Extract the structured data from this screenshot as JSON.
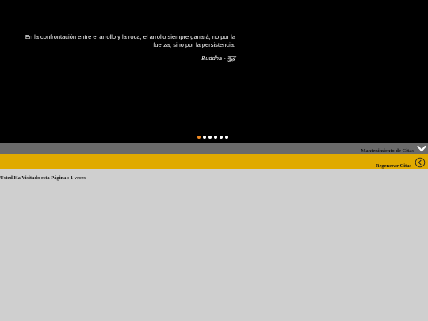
{
  "slider": {
    "quote": "En la confrontación entre el arrollo y la roca, el arrollo siempre ganará, no por la fuerza, sino por la persistencia.",
    "author": "Buddha - बुद्ध",
    "dot_count": 6,
    "active_index": 0
  },
  "header": {
    "maintenance_label": "Mantenimiento de Citas",
    "regenerate_label": "Regenerar Citas"
  },
  "footer": {
    "visits_text": "Usted Ha Visitado esta Página : 1 veces"
  },
  "icons": {
    "menu_toggle": "chevron-down-icon",
    "regenerate": "circle-arrow-left-icon"
  },
  "colors": {
    "hero_bg": "#000000",
    "grey_bar": "#6a6a6a",
    "yellow_bar": "#e0aa00",
    "page_bg": "#cfcfcf",
    "active_dot": "#f08a24"
  }
}
